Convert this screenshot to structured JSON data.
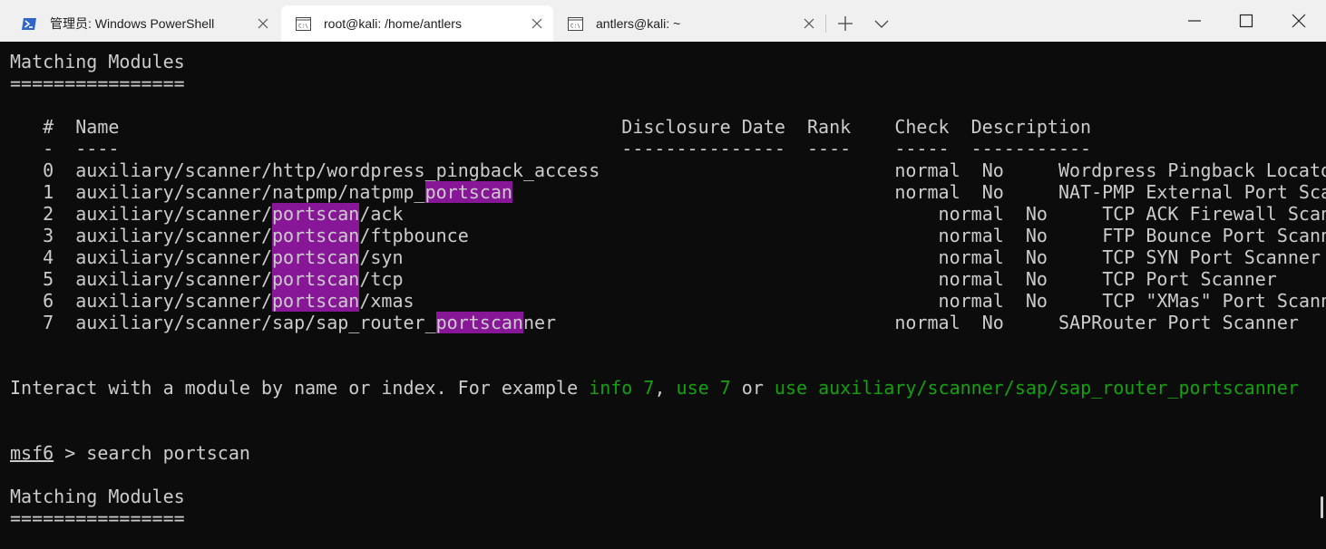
{
  "tabs": [
    {
      "title": "管理员: Windows PowerShell",
      "icon": "powershell-icon"
    },
    {
      "title": "root@kali: /home/antlers",
      "icon": "terminal-icon"
    },
    {
      "title": "antlers@kali: ~",
      "icon": "terminal-icon"
    }
  ],
  "colors": {
    "background": "#0c0c0c",
    "foreground": "#cccccc",
    "highlight": "#881798",
    "green": "#13a10e",
    "titlebar": "#f0f0f0"
  },
  "terminal": {
    "heading1": "Matching Modules",
    "rule1": "================",
    "header": "   #  Name                                              Disclosure Date  Rank    Check  Description",
    "dashes": "   -  ----                                              ---------------  ----    -----  -----------",
    "rows": [
      {
        "idx": "0",
        "pre": "auxiliary/scanner/http/wordpress_pingback_access",
        "hl": "",
        "post": "",
        "pad": "          ",
        "rank": "normal",
        "check": "No",
        "desc": "Wordpress Pingback Locator"
      },
      {
        "idx": "1",
        "pre": "auxiliary/scanner/natpmp/natpmp_",
        "hl": "portscan",
        "post": "",
        "pad": "                  ",
        "rank": "normal",
        "check": "No",
        "desc": "NAT-PMP External Port Scanner"
      },
      {
        "idx": "2",
        "pre": "auxiliary/scanner/",
        "hl": "portscan",
        "post": "/ack",
        "pad": "                                ",
        "rank": "normal",
        "check": "No",
        "desc": "TCP ACK Firewall Scanner"
      },
      {
        "idx": "3",
        "pre": "auxiliary/scanner/",
        "hl": "portscan",
        "post": "/ftpbounce",
        "pad": "                          ",
        "rank": "normal",
        "check": "No",
        "desc": "FTP Bounce Port Scanner"
      },
      {
        "idx": "4",
        "pre": "auxiliary/scanner/",
        "hl": "portscan",
        "post": "/syn",
        "pad": "                                ",
        "rank": "normal",
        "check": "No",
        "desc": "TCP SYN Port Scanner"
      },
      {
        "idx": "5",
        "pre": "auxiliary/scanner/",
        "hl": "portscan",
        "post": "/tcp",
        "pad": "                                ",
        "rank": "normal",
        "check": "No",
        "desc": "TCP Port Scanner"
      },
      {
        "idx": "6",
        "pre": "auxiliary/scanner/",
        "hl": "portscan",
        "post": "/xmas",
        "pad": "                               ",
        "rank": "normal",
        "check": "No",
        "desc": "TCP \"XMas\" Port Scanner"
      },
      {
        "idx": "7",
        "pre": "auxiliary/scanner/sap/sap_router_",
        "hl": "portscan",
        "post": "ner",
        "pad": "              ",
        "rank": "normal",
        "check": "No",
        "desc": "SAPRouter Port Scanner"
      }
    ],
    "interact": {
      "prefix": "Interact with a module by name or index. For example ",
      "info": "info 7",
      "comma": ", ",
      "use": "use 7",
      "or": " or ",
      "use_full": "use auxiliary/scanner/sap/sap_router_portscanner"
    },
    "prompt": {
      "name": "msf6",
      "arrow": " > ",
      "command": "search portscan"
    },
    "heading2": "Matching Modules",
    "rule2": "================"
  }
}
